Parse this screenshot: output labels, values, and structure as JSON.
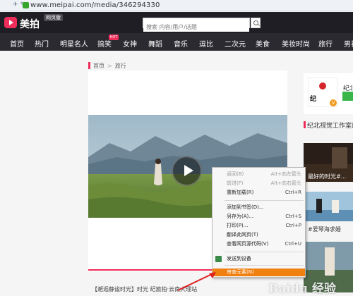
{
  "browser": {
    "url": "www.meipai.com/media/346294330"
  },
  "header": {
    "logo_text": "美拍",
    "web_badge": "网页版",
    "search_placeholder": "搜索 内容/用户/话题"
  },
  "nav": {
    "items": [
      "首页",
      "热门",
      "明星名人",
      "搞笑",
      "女神",
      "舞蹈",
      "音乐",
      "逗比",
      "二次元",
      "美食",
      "美妆时尚",
      "旅行",
      "男神"
    ],
    "hot_badge": "HOT"
  },
  "breadcrumb": {
    "home": "首页",
    "sep": ">",
    "current": "旅行"
  },
  "video": {
    "title": "【邂逅静谧时光】时光 纪旅拍·云南大理站"
  },
  "author": {
    "name": "纪北",
    "verified_badge": "V"
  },
  "related": {
    "title": "纪北视觉工作室的",
    "items": [
      {
        "caption": "最好的时光#..."
      },
      {
        "caption": "#爱琴海求婚"
      },
      {
        "caption": ""
      }
    ]
  },
  "context_menu": {
    "items": [
      {
        "label": "返回(B)",
        "shortcut": "Alt+向左箭头",
        "disabled": true
      },
      {
        "label": "前进(F)",
        "shortcut": "Alt+向右箭头",
        "disabled": true
      },
      {
        "label": "重新加载(R)",
        "shortcut": "Ctrl+R",
        "disabled": false
      },
      {
        "label": "添加到书签(D)...",
        "shortcut": "",
        "disabled": false
      },
      {
        "label": "另存为(A)...",
        "shortcut": "Ctrl+S",
        "disabled": false
      },
      {
        "label": "打印(P)...",
        "shortcut": "Ctrl+P",
        "disabled": false
      },
      {
        "label": "翻译此网页(T)",
        "shortcut": "",
        "disabled": false
      },
      {
        "label": "查看网页源代码(V)",
        "shortcut": "Ctrl+U",
        "disabled": false
      },
      {
        "label": "发送到设备",
        "shortcut": "",
        "disabled": false
      },
      {
        "label": "审查元素(N)",
        "shortcut": "",
        "disabled": false,
        "highlighted": true
      }
    ]
  },
  "watermark": "Baidu 经验",
  "colors": {
    "accent": "#ee2d5a",
    "header_bg": "#1f1e24",
    "menu_highlight": "#f08010"
  }
}
